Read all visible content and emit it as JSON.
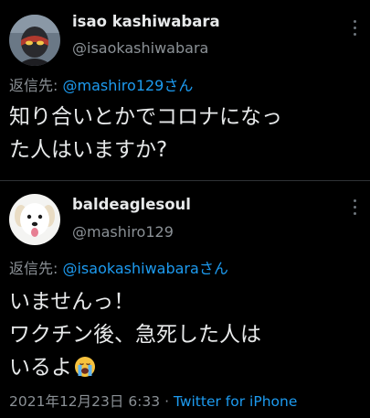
{
  "tweets": [
    {
      "display_name": "isao kashiwabara",
      "handle": "@isaokashiwabara",
      "reply_prefix": "返信先: ",
      "reply_mention": "@mashiro129",
      "reply_suffix": "さん",
      "text_lines": [
        "知り合いとかでコロナになっ",
        "た人はいますか?"
      ],
      "avatar_icon": "masked-figure-avatar"
    },
    {
      "display_name": "baldeaglesoul",
      "handle": "@mashiro129",
      "reply_prefix": "返信先: ",
      "reply_mention": "@isaokashiwabara",
      "reply_suffix": "さん",
      "text_lines": [
        "いませんっ！",
        "ワクチン後、急死した人は",
        "いるよ"
      ],
      "text_emoji": "loudly-crying-face-emoji",
      "avatar_icon": "white-dog-avatar",
      "timestamp": "2021年12月23日 6:33",
      "separator": " · ",
      "source": "Twitter for iPhone"
    }
  ],
  "colors": {
    "background": "#000000",
    "text": "#e7e9ea",
    "secondary": "#8b9196",
    "accent": "#1d9bf0",
    "divider": "#2f3336"
  }
}
